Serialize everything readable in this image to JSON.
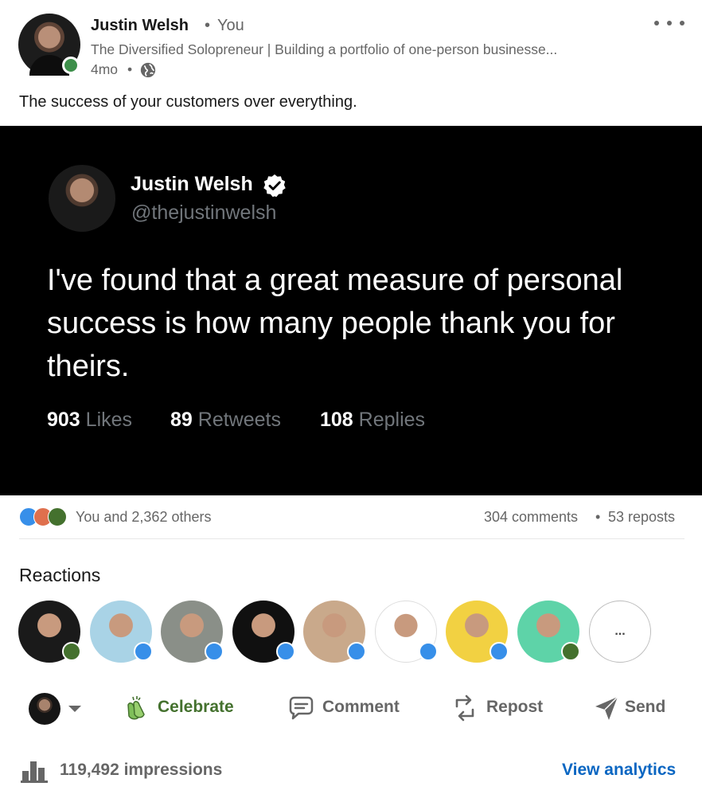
{
  "post": {
    "author": {
      "name": "Justin Welsh",
      "relation": "You",
      "headline": "The Diversified Solopreneur | Building a portfolio of one-person businesse...",
      "age": "4mo",
      "separator": "•"
    },
    "text": "The success of your customers over everything.",
    "image_tweet": {
      "name": "Justin Welsh",
      "handle": "@thejustinwelsh",
      "body": "I've found that a great measure of personal success is how many people thank you for theirs.",
      "stats": [
        {
          "count": "903",
          "label": "Likes"
        },
        {
          "count": "89",
          "label": "Retweets"
        },
        {
          "count": "108",
          "label": "Replies"
        }
      ]
    }
  },
  "social": {
    "reactions_text": "You and 2,362 others",
    "comments": "304 comments",
    "separator": "•",
    "reposts": "53 reposts",
    "reaction_types": [
      "like-icon",
      "love-icon",
      "celebrate-icon"
    ]
  },
  "reactions": {
    "title": "Reactions",
    "more_label": "...",
    "people": [
      {
        "badge": "celebrate",
        "bg": "#1a1a1a"
      },
      {
        "badge": "like",
        "bg": "#a9d3e6"
      },
      {
        "badge": "like",
        "bg": "#8a8f88"
      },
      {
        "badge": "like",
        "bg": "#101010"
      },
      {
        "badge": "like",
        "bg": "#c9a98b"
      },
      {
        "badge": "like",
        "bg": "#ffffff"
      },
      {
        "badge": "like",
        "bg": "#f2d142"
      },
      {
        "badge": "celebrate",
        "bg": "#5ed3a8"
      }
    ]
  },
  "actions": {
    "celebrate": "Celebrate",
    "comment": "Comment",
    "repost": "Repost",
    "send": "Send"
  },
  "analytics": {
    "impressions": "119,492 impressions",
    "view_label": "View analytics"
  },
  "colors": {
    "celebrate_green": "#44712e",
    "like_blue": "#378fe9",
    "link_blue": "#0a66c2"
  }
}
